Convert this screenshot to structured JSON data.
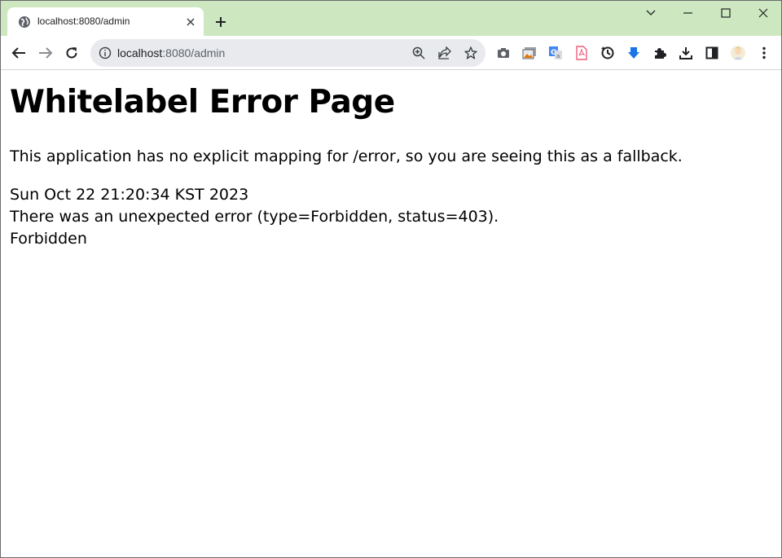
{
  "browser": {
    "tab": {
      "title": "localhost:8080/admin"
    },
    "address_bar": {
      "host": "localhost",
      "path": ":8080/admin"
    },
    "colors": {
      "frame": "#cde8c0",
      "omnibox": "#e8eaed",
      "icon": "#3c4043"
    }
  },
  "page": {
    "heading": "Whitelabel Error Page",
    "message": "This application has no explicit mapping for /error, so you are seeing this as a fallback.",
    "timestamp": "Sun Oct 22 21:20:34 KST 2023",
    "error_line": "There was an unexpected error (type=Forbidden, status=403).",
    "detail": "Forbidden"
  },
  "icons": [
    "globe-icon",
    "close-icon",
    "plus-icon",
    "chevron-down-icon",
    "minimize-icon",
    "maximize-icon",
    "back-icon",
    "forward-icon",
    "reload-icon",
    "info-icon",
    "zoom-icon",
    "share-icon",
    "star-icon",
    "camera-icon",
    "image-icon",
    "translate-icon",
    "pdf-icon",
    "sync-icon",
    "download-arrow-icon",
    "puzzle-icon",
    "download-icon",
    "side-panel-icon",
    "profile-avatar",
    "kebab-menu-icon"
  ]
}
